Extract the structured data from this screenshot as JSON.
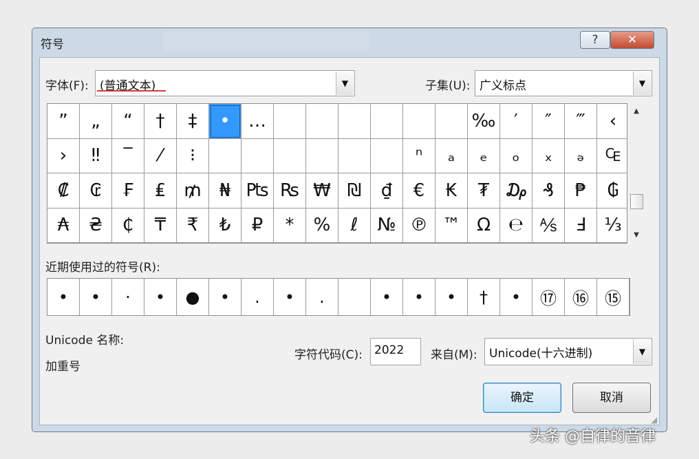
{
  "window": {
    "title": "符号",
    "help_label": "?",
    "close_label": "✕"
  },
  "font": {
    "label": "字体(F):",
    "value": "(普通文本)"
  },
  "subset": {
    "label": "子集(U):",
    "value": "广义标点"
  },
  "symbols": [
    "”",
    "„",
    "“",
    "†",
    "‡",
    "•",
    "…",
    "",
    "",
    "",
    "",
    "",
    "",
    "‰",
    "′",
    "″",
    "‴",
    "‹",
    "›",
    "‼",
    "‾",
    "⁄",
    "⁝",
    "",
    "",
    "",
    "",
    "",
    "",
    "ⁿ",
    "ₐ",
    "ₑ",
    "ₒ",
    "ₓ",
    "ₔ",
    "₠",
    "₡",
    "₢",
    "₣",
    "₤",
    "₥",
    "₦",
    "₧",
    "₨",
    "₩",
    "₪",
    "₫",
    "€",
    "₭",
    "₮",
    "₯",
    "₰",
    "₱",
    "₲",
    "₳",
    "₴",
    "₵",
    "₸",
    "₹",
    "₺",
    "₽",
    "*",
    "%",
    "ℓ",
    "№",
    "℗",
    "™",
    "Ω",
    "℮",
    "⅍",
    "Ⅎ",
    "⅓"
  ],
  "selected_symbol": "•",
  "recent": {
    "label": "近期使用过的符号(R):",
    "items": [
      "•",
      "•",
      "·",
      "•",
      "●",
      "•",
      ".",
      "•",
      ".",
      "",
      "•",
      "•",
      "•",
      "†",
      "•",
      "⑰",
      "⑯",
      "⑮"
    ]
  },
  "unicode_name": {
    "label": "Unicode 名称:",
    "value": "加重号"
  },
  "char_code": {
    "label": "字符代码(C):",
    "value": "2022"
  },
  "from": {
    "label": "来自(M):",
    "value": "Unicode(十六进制)"
  },
  "buttons": {
    "ok": "确定",
    "cancel": "取消"
  },
  "watermark": "头条 @自律的音律",
  "colors": {
    "selection": "#3399ff",
    "title_bar": "#ccd9e6",
    "close_button": "#c24b33"
  }
}
